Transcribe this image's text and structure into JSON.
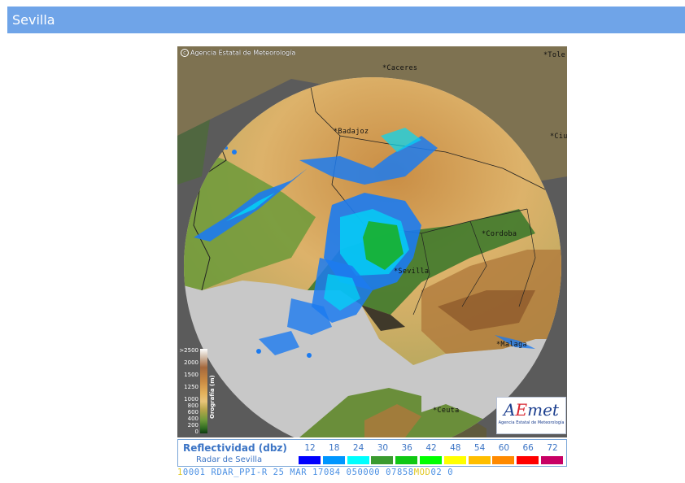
{
  "page": {
    "title": "Sevilla"
  },
  "map": {
    "credit": "Agencia Estatal de Meteorología",
    "credit_icon": "copyright-icon",
    "cities": [
      {
        "id": "caceres",
        "label": "*Caceres"
      },
      {
        "id": "toledo",
        "label": "*Tole"
      },
      {
        "id": "badajoz",
        "label": "*Badajoz"
      },
      {
        "id": "ciudad-real",
        "label": "*Ciu"
      },
      {
        "id": "cordoba",
        "label": "*Cordoba"
      },
      {
        "id": "sevilla",
        "label": "*Sevilla"
      },
      {
        "id": "malaga",
        "label": "*Malaga"
      },
      {
        "id": "ceuta",
        "label": "*Ceuta"
      }
    ],
    "colors": {
      "background": "#5b5b5b",
      "sea_in_range": "#c8c8c8",
      "radar_blue": "#1c7bf0",
      "radar_cyan": "#00d8f8",
      "radar_green": "#18b02a"
    }
  },
  "orography": {
    "title": "Orografía (m)",
    "labels": [
      ">2500",
      "2000",
      "1500",
      "1250",
      "1000",
      "800",
      "600",
      "400",
      "200",
      "0"
    ]
  },
  "logo": {
    "name": "AEMet",
    "subtitle": "Agencia Estatal de Meteorología"
  },
  "reflectivity": {
    "title": "Reflectividad (dbz)",
    "subtitle": "Radar de Sevilla",
    "scale": [
      {
        "value": "12",
        "color": "#0000fe"
      },
      {
        "value": "18",
        "color": "#0096ff"
      },
      {
        "value": "24",
        "color": "#00fffe"
      },
      {
        "value": "30",
        "color": "#3a9b2f"
      },
      {
        "value": "36",
        "color": "#10c814"
      },
      {
        "value": "42",
        "color": "#00ff00"
      },
      {
        "value": "48",
        "color": "#ffff00"
      },
      {
        "value": "54",
        "color": "#ffbe00"
      },
      {
        "value": "60",
        "color": "#ff8a00"
      },
      {
        "value": "66",
        "color": "#ff0000"
      },
      {
        "value": "72",
        "color": "#c80064"
      }
    ]
  },
  "status": {
    "prefix": "1",
    "text_a": "0001 RDAR_PPI-R   25 MAR 17084 050000 07858",
    "text_b": "MOD",
    "text_c": "02 0"
  }
}
